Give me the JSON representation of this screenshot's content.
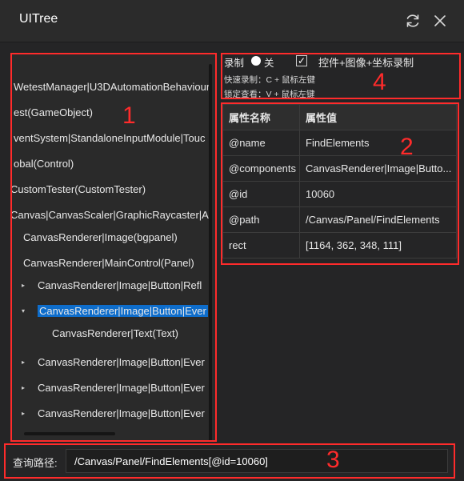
{
  "window": {
    "title": "UITree"
  },
  "icons": {
    "refresh": "refresh-icon",
    "close": "close-icon"
  },
  "accent_color": "#0e6dcb",
  "annotation_color": "#ff2b2b",
  "callouts": [
    "1",
    "2",
    "3",
    "4"
  ],
  "tree": {
    "nodes": [
      {
        "label": "WetestManager|U3DAutomationBehaviour",
        "arrow": ""
      },
      {
        "label": "est(GameObject)",
        "arrow": ""
      },
      {
        "label": "ventSystem|StandaloneInputModule|Touc",
        "arrow": ""
      },
      {
        "label": "obal(Control)",
        "arrow": ""
      },
      {
        "label": "CustomTester(CustomTester)",
        "arrow": ""
      },
      {
        "label": "Canvas|CanvasScaler|GraphicRaycaster|Au",
        "arrow": ""
      },
      {
        "label": "CanvasRenderer|Image(bgpanel)",
        "arrow": ""
      },
      {
        "label": "CanvasRenderer|MainControl(Panel)",
        "arrow": ""
      },
      {
        "label": "CanvasRenderer|Image|Button|Refl",
        "arrow": "▸"
      },
      {
        "label": "CanvasRenderer|Image|Button|Ever",
        "arrow": "▾",
        "selected": true
      },
      {
        "label": "CanvasRenderer|Text(Text)",
        "arrow": ""
      },
      {
        "label": "CanvasRenderer|Image|Button|Ever",
        "arrow": "▸"
      },
      {
        "label": "CanvasRenderer|Image|Button|Ever",
        "arrow": "▸"
      },
      {
        "label": "CanvasRenderer|Image|Button|Ever",
        "arrow": "▸"
      }
    ]
  },
  "recorder": {
    "record_label": "录制",
    "off_label": "关",
    "checkbox_label": "控件+图像+坐标录制",
    "checkbox_checked": true,
    "hint_quick": "快速录制：C + 鼠标左键",
    "hint_lock": "锁定查看：V + 鼠标左键"
  },
  "properties": {
    "header_name": "属性名称",
    "header_value": "属性值",
    "rows": [
      {
        "name": "@name",
        "value": "FindElements"
      },
      {
        "name": "@components",
        "value": "CanvasRenderer|Image|Butto..."
      },
      {
        "name": "@id",
        "value": "10060"
      },
      {
        "name": "@path",
        "value": "/Canvas/Panel/FindElements"
      },
      {
        "name": "rect",
        "value": "[1164, 362, 348, 111]"
      }
    ]
  },
  "query": {
    "label": "查询路径:",
    "value": "/Canvas/Panel/FindElements[@id=10060]"
  }
}
